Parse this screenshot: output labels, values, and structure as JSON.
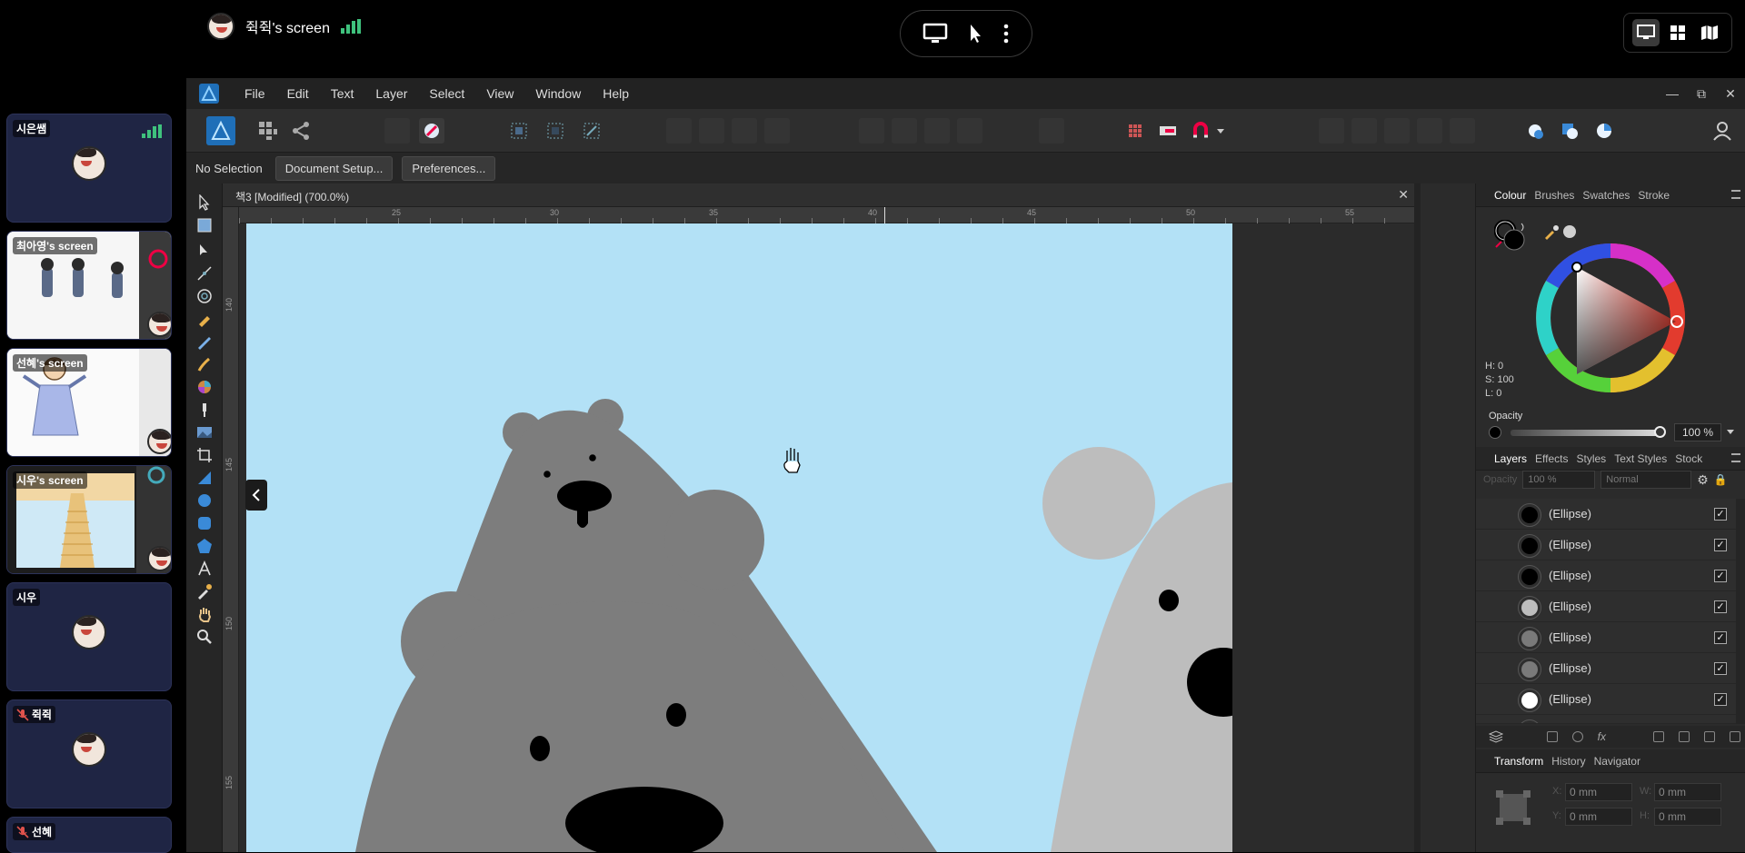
{
  "meeting": {
    "sharer_name": "쥑쥑's screen",
    "colors": {
      "signal": "#3fc27d",
      "tile_bg": "#1f2544",
      "muted": "#e0524c"
    }
  },
  "participants": [
    {
      "name": "시은쌤",
      "kind": "avatar",
      "signal": true
    },
    {
      "name": "최아영's screen",
      "kind": "screen"
    },
    {
      "name": "선혜's screen",
      "kind": "screen"
    },
    {
      "name": "시우's screen",
      "kind": "screen"
    },
    {
      "name": "시우",
      "kind": "avatar"
    },
    {
      "name": "쥑쥑",
      "kind": "avatar",
      "muted": true
    },
    {
      "name": "선혜",
      "kind": "avatar",
      "muted": true
    }
  ],
  "app": {
    "menu": [
      "File",
      "Edit",
      "Text",
      "Layer",
      "Select",
      "View",
      "Window",
      "Help"
    ],
    "window_controls": [
      "minimize",
      "restore",
      "close"
    ],
    "context": {
      "selection": "No Selection",
      "document_setup": "Document Setup...",
      "preferences": "Preferences..."
    },
    "document": {
      "title": "책3 [Modified] (700.0%)",
      "ruler_unit": "mm",
      "h_ticks": [
        "25",
        "30",
        "35",
        "40",
        "45",
        "50",
        "55"
      ],
      "v_ticks": [
        "140",
        "145",
        "150",
        "155"
      ],
      "canvas_color": "#b3e1f6"
    },
    "colour_panel": {
      "tabs": [
        "Colour",
        "Brushes",
        "Swatches",
        "Stroke"
      ],
      "active_tab": "Colour",
      "h": "H: 0",
      "s": "S: 100",
      "l": "L: 0",
      "opacity_label": "Opacity",
      "opacity_value": "100 %",
      "opacity_level": 1.0
    },
    "layers_panel": {
      "tabs": [
        "Layers",
        "Effects",
        "Styles",
        "Text Styles",
        "Stock"
      ],
      "active_tab": "Layers",
      "opacity_label": "Opacity",
      "opacity_value": "100 %",
      "blend_mode": "Normal",
      "layers": [
        {
          "name": "(Ellipse)",
          "fill": "#000000",
          "visible": true
        },
        {
          "name": "(Ellipse)",
          "fill": "#000000",
          "visible": true
        },
        {
          "name": "(Ellipse)",
          "fill": "#000000",
          "visible": true
        },
        {
          "name": "(Ellipse)",
          "fill": "#bdbdbd",
          "visible": true
        },
        {
          "name": "(Ellipse)",
          "fill": "#7a7a7a",
          "visible": true
        },
        {
          "name": "(Ellipse)",
          "fill": "#7a7a7a",
          "visible": true
        },
        {
          "name": "(Ellipse)",
          "fill": "#ffffff",
          "visible": true
        }
      ]
    },
    "transform_panel": {
      "tabs": [
        "Transform",
        "History",
        "Navigator"
      ],
      "active_tab": "Transform",
      "fields": {
        "x": "0 mm",
        "y": "0 mm",
        "w": "0 mm",
        "h": "0 mm"
      },
      "labels": {
        "x": "X:",
        "y": "Y:",
        "w": "W:",
        "h": "H:"
      }
    }
  }
}
